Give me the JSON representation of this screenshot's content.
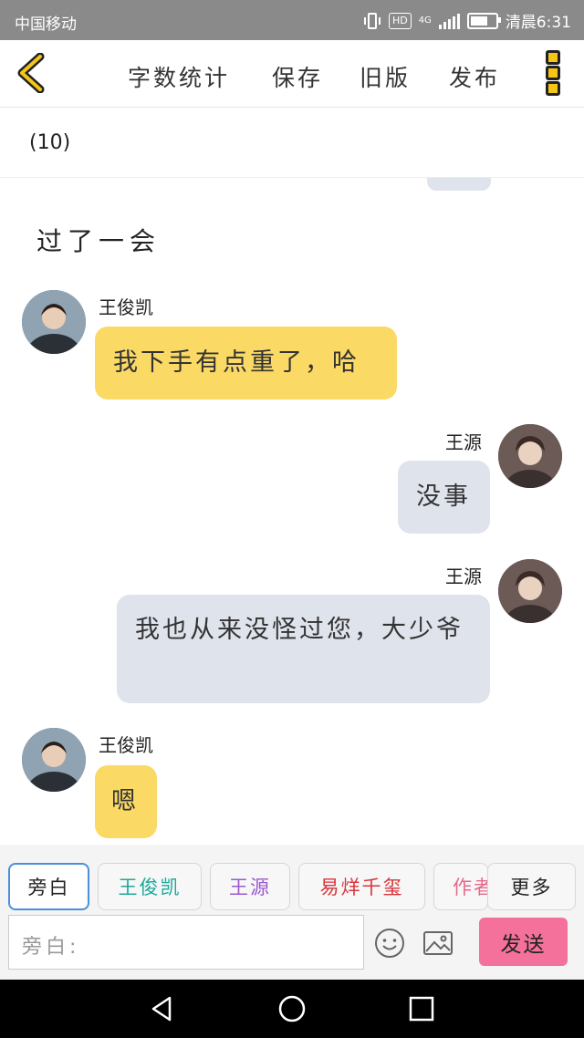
{
  "status_bar": {
    "carrier": "中国移动",
    "hd": "HD",
    "network": "4G",
    "time": "清晨6:31"
  },
  "toolbar": {
    "word_count": "字数统计",
    "save": "保存",
    "old_version": "旧版",
    "publish": "发布"
  },
  "count": "(10)",
  "chat": {
    "narration": "过了一会",
    "messages": [
      {
        "side": "left",
        "name": "王俊凯",
        "text": "我下手有点重了，哈"
      },
      {
        "side": "right",
        "name": "王源",
        "text": "没事"
      },
      {
        "side": "right",
        "name": "王源",
        "text": "我也从来没怪过您，大少爷"
      },
      {
        "side": "left",
        "name": "王俊凯",
        "text": "嗯"
      }
    ]
  },
  "roles": {
    "narrator": "旁白",
    "r1": "王俊凯",
    "r2": "王源",
    "r3": "易烊千玺",
    "r4": "作者",
    "more": "更多"
  },
  "role_colors": {
    "r1": "#1aa89a",
    "r2": "#9b59d0",
    "r3": "#d9343a",
    "r4": "#e56a8a"
  },
  "input": {
    "placeholder": "旁白:"
  },
  "send_label": "发送"
}
